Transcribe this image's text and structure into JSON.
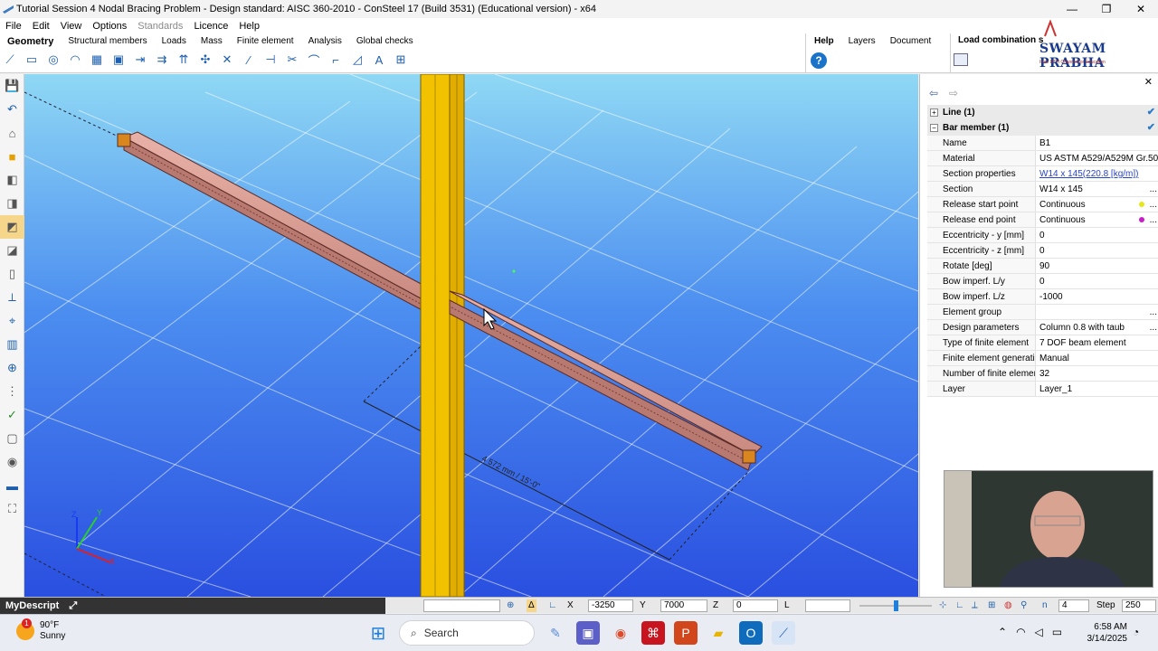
{
  "window": {
    "title": "Tutorial Session 4 Nodal Bracing Problem - Design standard: AISC 360-2010 - ConSteel 17 (Build 3531) (Educational version) - x64",
    "controls": [
      "—",
      "❐",
      "✕"
    ]
  },
  "menu": [
    "File",
    "Edit",
    "View",
    "Options",
    "Standards",
    "Licence",
    "Help"
  ],
  "ribbon": {
    "tabs": [
      "Geometry",
      "Structural members",
      "Loads",
      "Mass",
      "Finite element",
      "Analysis",
      "Global checks"
    ],
    "right_tabs": [
      "Help",
      "Layers",
      "Document"
    ],
    "load_combination": "Load combination s",
    "help_icon": "?"
  },
  "logo": {
    "brand": "SWAYAM PRABHA",
    "tagline": "Free DTH Channel for Education"
  },
  "properties": {
    "groups": [
      "Line (1)",
      "Bar member (1)"
    ],
    "rows": [
      {
        "name": "Name",
        "value": "B1"
      },
      {
        "name": "Material",
        "value": "US ASTM A529/A529M Gr.50"
      },
      {
        "name": "Section properties",
        "value": "W14 x 145(220.8 [kg/m])"
      },
      {
        "name": "Section",
        "value": "W14 x 145"
      },
      {
        "name": "Release start point",
        "value": "Continuous"
      },
      {
        "name": "Release end point",
        "value": "Continuous"
      },
      {
        "name": "Eccentricity - y [mm]",
        "value": "0"
      },
      {
        "name": "Eccentricity - z [mm]",
        "value": "0"
      },
      {
        "name": "Rotate [deg]",
        "value": "90"
      },
      {
        "name": "Bow imperf. L/y",
        "value": "0"
      },
      {
        "name": "Bow imperf. L/z",
        "value": "-1000"
      },
      {
        "name": "Element group",
        "value": ""
      },
      {
        "name": "Design parameters",
        "value": "Column 0.8 with taub"
      },
      {
        "name": "Type of finite element",
        "value": "7 DOF beam element"
      },
      {
        "name": "Finite element generatio",
        "value": "Manual"
      },
      {
        "name": "Number of finite elemen",
        "value": "32"
      },
      {
        "name": "Layer",
        "value": "Layer_1"
      }
    ],
    "colors": {
      "start_dot": "#e6e61a",
      "end_dot": "#c81ec8",
      "link": "#2845c8"
    }
  },
  "viewport": {
    "dimension_label": "4 572 mm / 15'-0\"",
    "axes": [
      "Z",
      "Y",
      "X"
    ],
    "colors": {
      "sky_top": "#8fd8f4",
      "sky_bottom": "#2a4fe0",
      "beam": "#d79a90",
      "column": "#f2c200"
    }
  },
  "status": {
    "panel_title": "MyDescript",
    "x_label": "X",
    "x_value": "-3250",
    "y_label": "Y",
    "y_value": "7000",
    "z_label": "Z",
    "z_value": "0",
    "l_label": "L",
    "n_label": "n",
    "n_value": "4",
    "step_label": "Step",
    "step_value": "250"
  },
  "taskbar": {
    "temperature": "90°F",
    "condition": "Sunny",
    "alert_count": "1",
    "search_placeholder": "Search",
    "time": "6:58 AM",
    "date": "3/14/2025"
  }
}
